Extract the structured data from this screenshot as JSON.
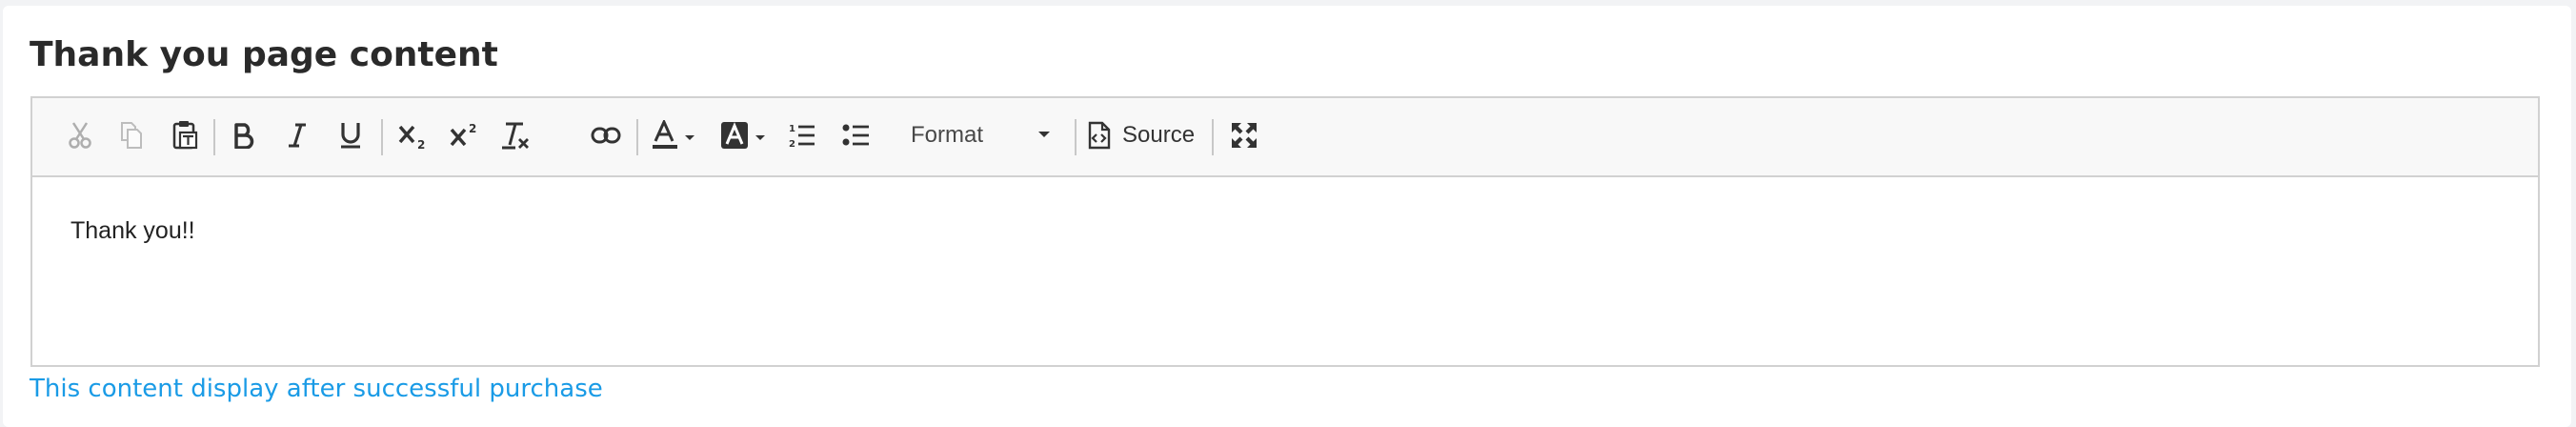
{
  "section": {
    "title": "Thank you page content"
  },
  "editor": {
    "toolbar": {
      "format_label": "Format",
      "source_label": "Source",
      "icons": [
        "cut-icon",
        "copy-icon",
        "paste-text-icon",
        "bold-icon",
        "italic-icon",
        "underline-icon",
        "subscript-icon",
        "superscript-icon",
        "remove-format-icon",
        "link-icon",
        "text-color-icon",
        "background-color-icon",
        "numbered-list-icon",
        "bulleted-list-icon",
        "format-dropdown",
        "source-icon",
        "maximize-icon"
      ]
    },
    "content": "Thank you!!"
  },
  "help_text": "This content display after successful purchase",
  "colors": {
    "help_text": "#1a9be6",
    "toolbar_bg": "#f8f8f8",
    "border": "#d1d1d1"
  }
}
